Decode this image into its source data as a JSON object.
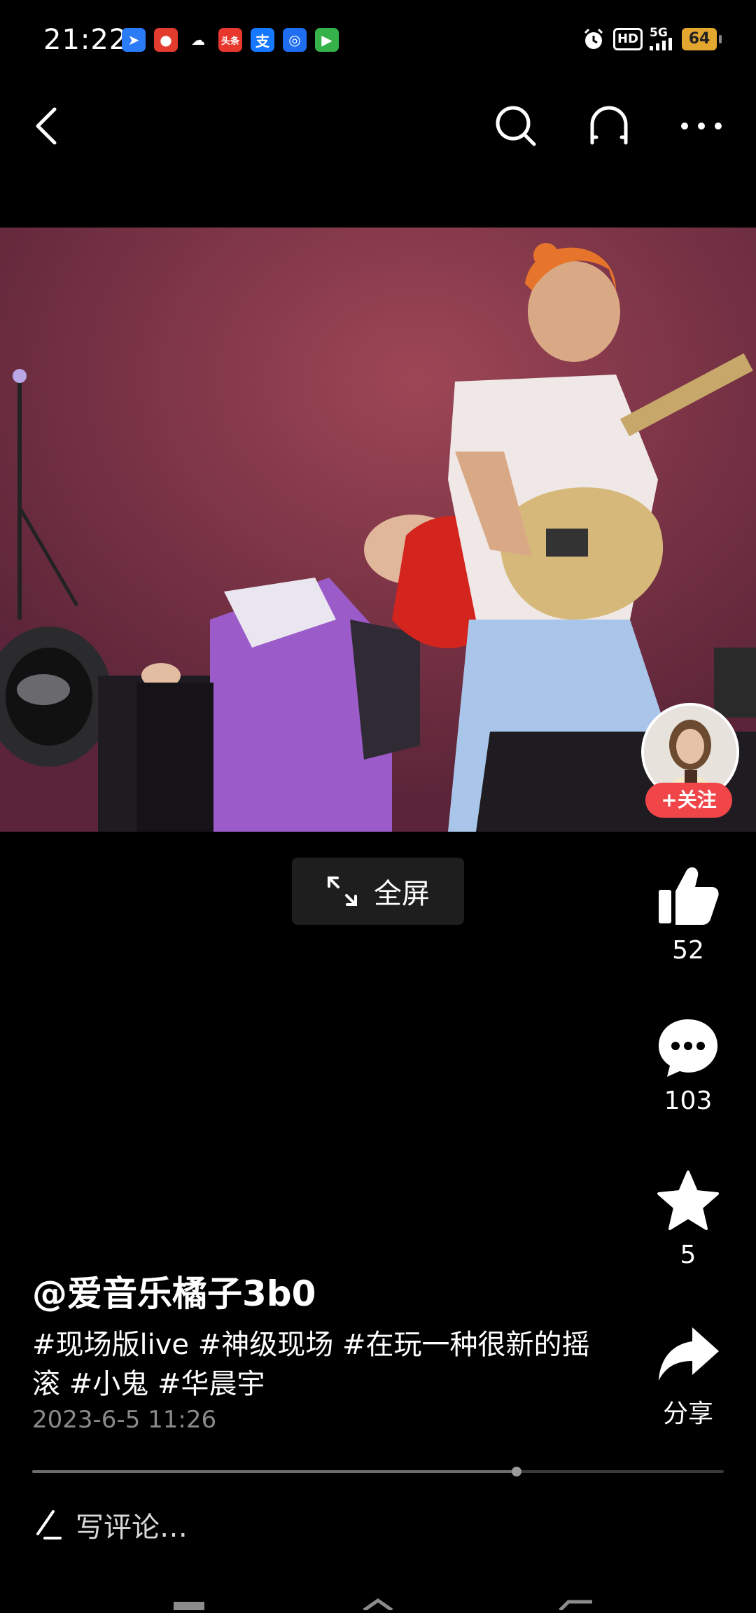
{
  "status_bar": {
    "time": "21:22",
    "notification_icons": [
      {
        "name": "app-blue-arrow-icon",
        "color": "#2a7bf6",
        "glyph": "➤"
      },
      {
        "name": "app-red-icon",
        "color": "#e33b2e",
        "glyph": "●"
      },
      {
        "name": "cloud-icon",
        "color": "#000000",
        "glyph": "☁"
      },
      {
        "name": "toutiao-icon",
        "color": "#e8382e",
        "glyph": "头条"
      },
      {
        "name": "alipay-icon",
        "color": "#1677ff",
        "glyph": "支"
      },
      {
        "name": "app-blue-circle-icon",
        "color": "#1f6ef2",
        "glyph": "◎"
      },
      {
        "name": "app-video-icon",
        "color": "#36b24a",
        "glyph": "▶"
      }
    ],
    "hd_label": "HD",
    "network_label": "5G",
    "battery_level": "64"
  },
  "colors": {
    "accent": "#f0464a",
    "background": "#000000"
  },
  "follow_label": "+关注",
  "fullscreen_label": "全屏",
  "actions": {
    "like_count": "52",
    "comment_count": "103",
    "favorite_count": "5",
    "share_label": "分享"
  },
  "post": {
    "author": "@爱音乐橘子3b0",
    "tags": "#现场版live #神级现场 #在玩一种很新的摇滚 #小鬼 #华晨宇",
    "date": "2023-6-5 11:26"
  },
  "progress": {
    "played_fraction": 0.7
  },
  "comment": {
    "placeholder": "写评论…"
  }
}
